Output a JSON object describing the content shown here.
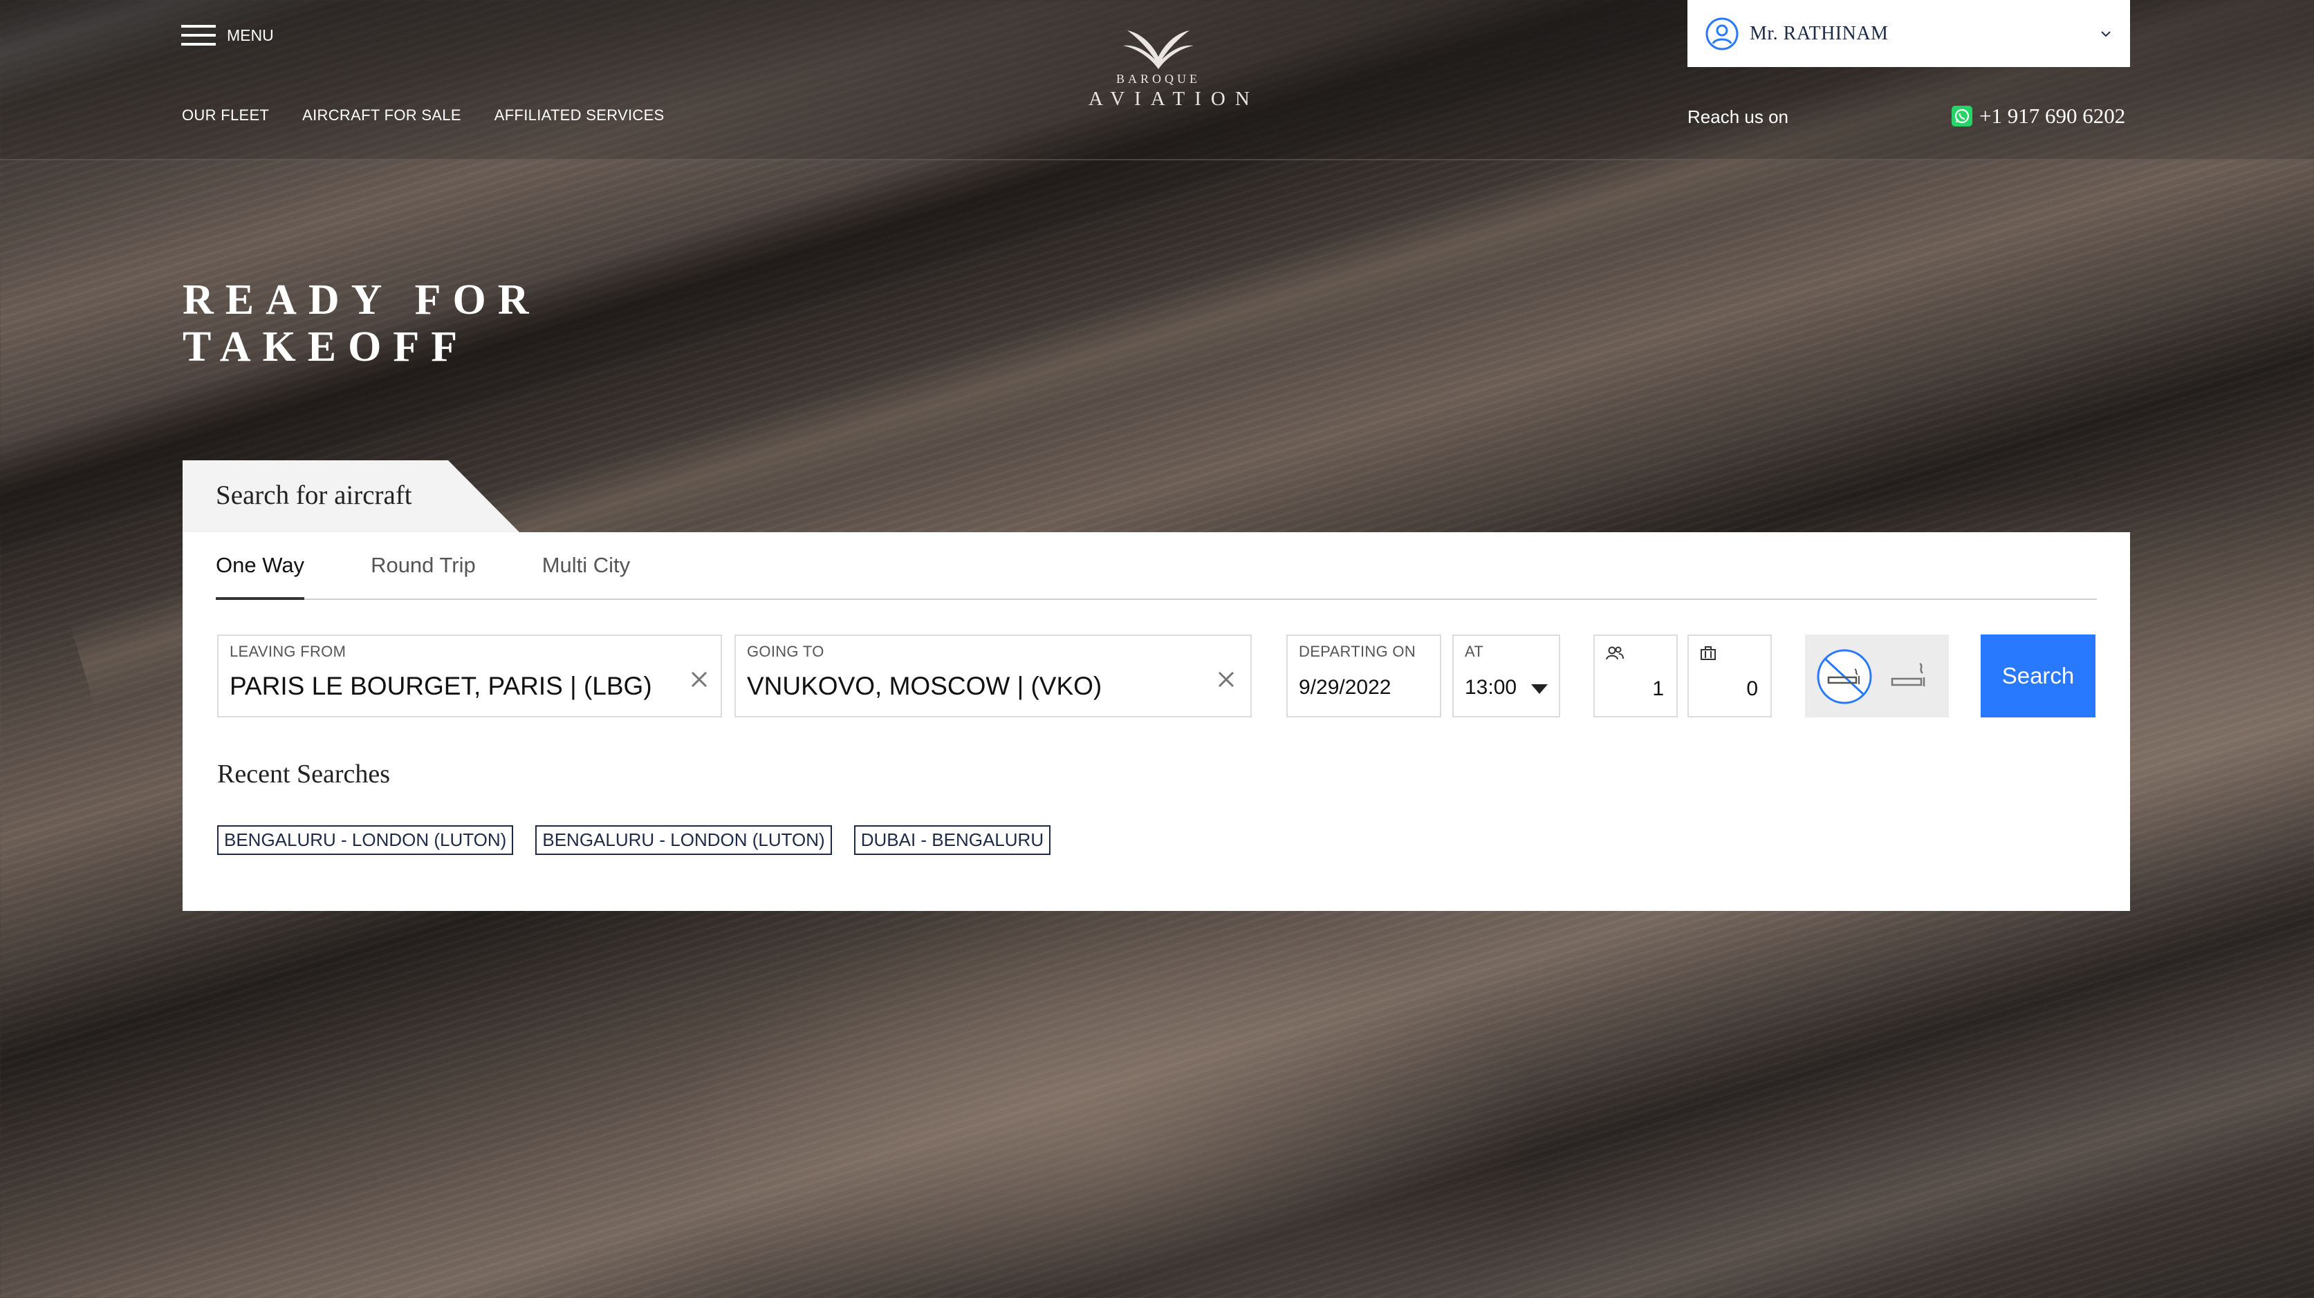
{
  "header": {
    "menu_label": "MENU",
    "nav": [
      "OUR FLEET",
      "AIRCRAFT FOR SALE",
      "AFFILIATED SERVICES"
    ],
    "logo": {
      "top": "BAROQUE",
      "bottom": "AVIATION"
    },
    "user_name": "Mr. RATHINAM",
    "reach_label": "Reach us on",
    "phone": "+1 917 690 6202"
  },
  "hero": {
    "title_line1": "READY FOR",
    "title_line2": "TAKEOFF"
  },
  "search": {
    "tab_title": "Search for aircraft",
    "trip_types": [
      "One Way",
      "Round Trip",
      "Multi City"
    ],
    "active_trip_type": "One Way",
    "leaving_from": {
      "label": "LEAVING FROM",
      "value": "PARIS LE BOURGET, PARIS | (LBG)"
    },
    "going_to": {
      "label": "GOING TO",
      "value": "VNUKOVO, MOSCOW | (VKO)"
    },
    "departing_on": {
      "label": "DEPARTING ON",
      "value": "9/29/2022"
    },
    "at": {
      "label": "AT",
      "value": "13:00"
    },
    "passengers": "1",
    "luggage": "0",
    "search_button": "Search"
  },
  "recent": {
    "title": "Recent Searches",
    "items": [
      "BENGALURU - LONDON (LUTON)",
      "BENGALURU - LONDON (LUTON)",
      "DUBAI - BENGALURU"
    ]
  },
  "colors": {
    "accent": "#2979ff",
    "navy": "#1d2a4a",
    "whatsapp": "#25d366"
  }
}
